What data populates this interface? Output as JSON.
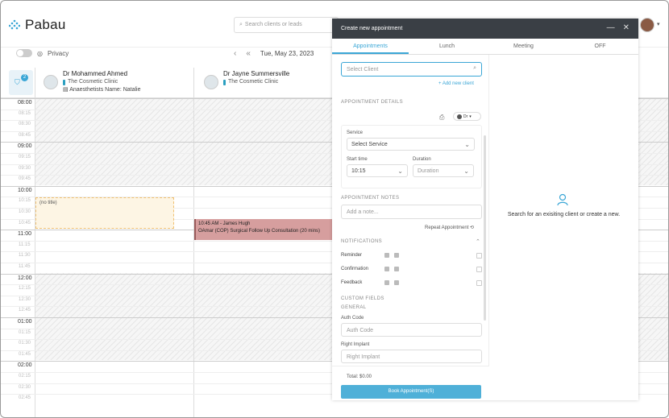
{
  "app": {
    "logo_text": "Pabau",
    "search_placeholder": "Search clients or leads"
  },
  "toolbar": {
    "privacy_label": "Privacy",
    "date": "Tue, May 23, 2023",
    "prev": "‹",
    "prev_double": "«"
  },
  "filter": {
    "badge_count": "2"
  },
  "staff": [
    {
      "name": "Dr Mohammed Ahmed",
      "clinic": "The Cosmetic Clinic",
      "anaesthetist": "Anaesthetists Name: Natalie"
    },
    {
      "name": "Dr Jayne Summersville",
      "clinic": "The Cosmetic Clinic"
    }
  ],
  "times": [
    {
      "label": "08:00",
      "hour": true
    },
    {
      "label": "08:15"
    },
    {
      "label": "08:30"
    },
    {
      "label": "08:45"
    },
    {
      "label": "09:00",
      "hour": true
    },
    {
      "label": "09:15"
    },
    {
      "label": "09:30"
    },
    {
      "label": "09:45"
    },
    {
      "label": "10:00",
      "hour": true
    },
    {
      "label": "10:15"
    },
    {
      "label": "10:30"
    },
    {
      "label": "10:45"
    },
    {
      "label": "11:00",
      "hour": true
    },
    {
      "label": "11:15"
    },
    {
      "label": "11:30"
    },
    {
      "label": "11:45"
    },
    {
      "label": "12:00",
      "hour": true
    },
    {
      "label": "12:15"
    },
    {
      "label": "12:30"
    },
    {
      "label": "12:45"
    },
    {
      "label": "01:00",
      "hour": true
    },
    {
      "label": "01:15"
    },
    {
      "label": "01:30"
    },
    {
      "label": "01:45"
    },
    {
      "label": "02:00",
      "hour": true
    },
    {
      "label": "02:15"
    },
    {
      "label": "02:30"
    },
    {
      "label": "02:45"
    }
  ],
  "events": {
    "placeholder": "(no title)",
    "appointment_time": "10:45 AM - James Hugh",
    "appointment_desc": "OAmar (COP) Surgical Follow Up Consultation (20 mins)"
  },
  "modal": {
    "title": "Create new appointment",
    "tabs": [
      "Appointments",
      "Lunch",
      "Meeting",
      "OFF"
    ],
    "select_client_placeholder": "Select Client",
    "add_new_client": "+ Add new client",
    "appointment_details": "APPOINTMENT DETAILS",
    "staff_chip": "Dr",
    "service_label": "Service",
    "service_placeholder": "Select Service",
    "start_time_label": "Start time",
    "start_time": "10:15",
    "duration_label": "Duration",
    "duration_placeholder": "Duration",
    "notes_heading": "APPOINTMENT NOTES",
    "note_placeholder": "Add a note...",
    "repeat": "Repeat Appointment",
    "notifications_heading": "NOTIFICATIONS",
    "notifications": [
      "Reminder",
      "Confirmation",
      "Feedback"
    ],
    "custom_fields_heading": "CUSTOM FIELDS",
    "general_heading": "GENERAL",
    "auth_code_label": "Auth Code",
    "auth_code_placeholder": "Auth Code",
    "right_implant_label": "Right Implant",
    "right_implant_placeholder": "Right Implant",
    "total": "Total: $0.00",
    "book_button": "Book Appointment(S)",
    "empty_state": "Search for an exisiting client or create a new."
  }
}
